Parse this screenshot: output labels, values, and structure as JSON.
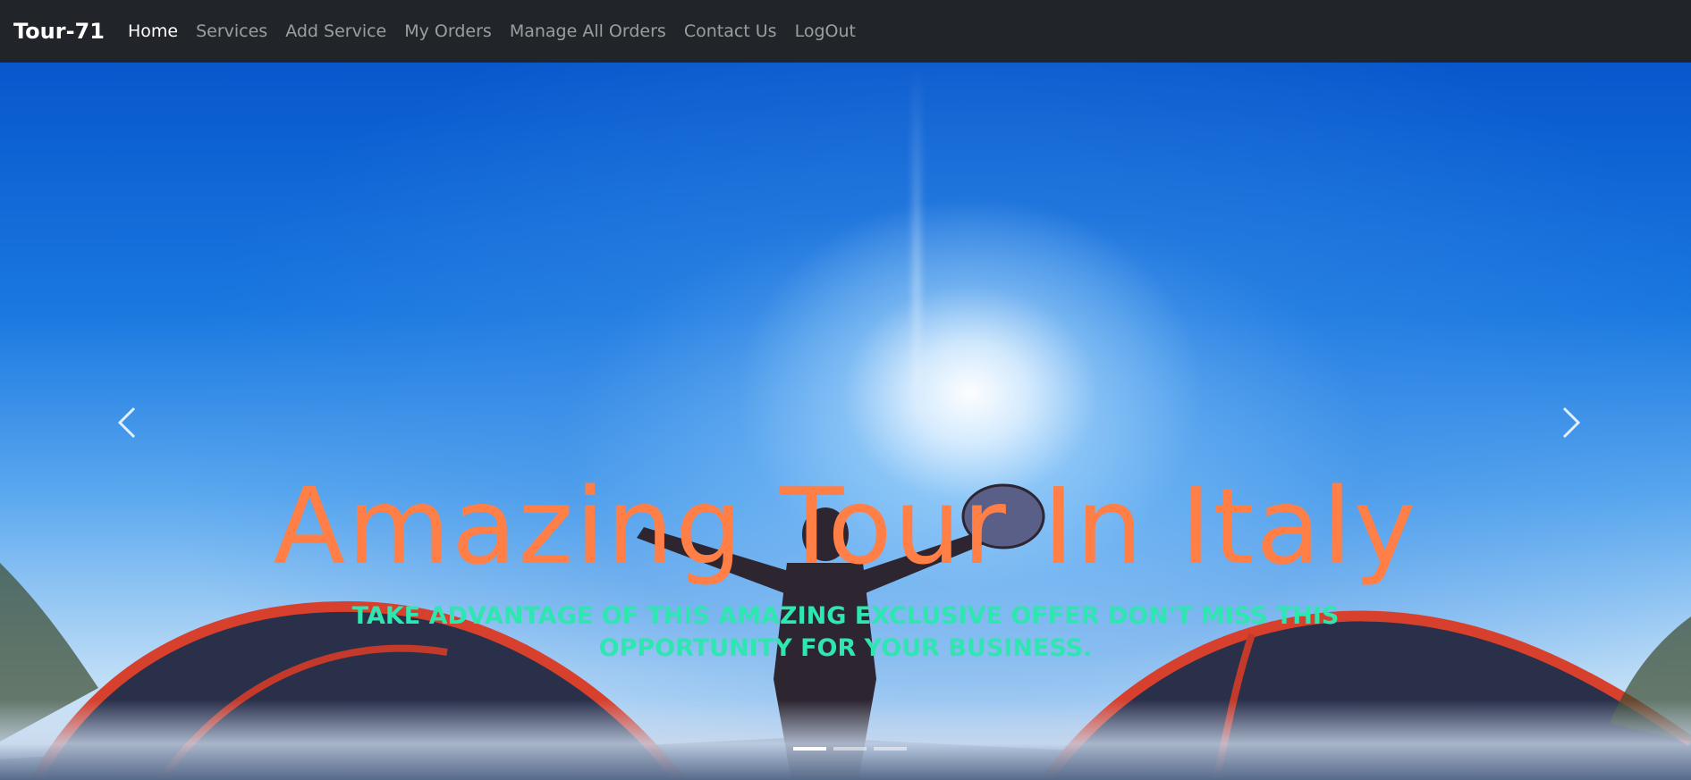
{
  "navbar": {
    "brand": "Tour-71",
    "links": [
      {
        "label": "Home"
      },
      {
        "label": "Services"
      },
      {
        "label": "Add Service"
      },
      {
        "label": "My Orders"
      },
      {
        "label": "Manage All Orders"
      },
      {
        "label": "Contact Us"
      },
      {
        "label": "LogOut"
      }
    ],
    "active_link": "Home"
  },
  "carousel": {
    "title": "Amazing Tour In Italy",
    "text": "TAKE ADVANTAGE OF THIS AMAZING EXCLUSIVE OFFER DON'T MISS THIS OPPORTUNITY FOR YOUR BUSINESS.",
    "slide_count": 3,
    "active_slide": 1,
    "prev_icon": "chevron-left-icon",
    "next_icon": "chevron-right-icon"
  },
  "colors": {
    "navbar_bg": "#212529",
    "title": "#ff7f47",
    "caption": "#2ee6b0"
  }
}
